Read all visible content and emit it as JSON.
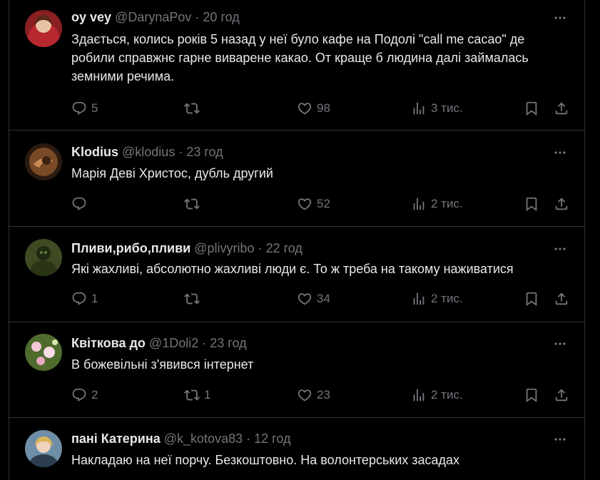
{
  "tweets": [
    {
      "name": "oy vey",
      "handle": "@DarynaPov",
      "time": "20 год",
      "text": "Здається, колись років 5 назад у неї було кафе на Подолі \"call me cacao\" де робили справжнє гарне виварене какао. От краще б людина далі займалась земними речима.",
      "replies": "5",
      "reposts": "",
      "likes": "98",
      "views": "3 тис."
    },
    {
      "name": "Klodius",
      "handle": "@klodius",
      "time": "23 год",
      "text": "Марія Деві Христос, дубль другий",
      "replies": "",
      "reposts": "",
      "likes": "52",
      "views": "2 тис."
    },
    {
      "name": "Пливи,рибо,пливи",
      "handle": "@plivyribo",
      "time": "22 год",
      "text": "Які жахливі, абсолютно жахливі люди є. То ж треба на такому наживатися",
      "replies": "1",
      "reposts": "",
      "likes": "34",
      "views": "2 тис."
    },
    {
      "name": "Квіткова до",
      "handle": "@1Doli2",
      "time": "23 год",
      "text": "В божевільні з'явився інтернет",
      "replies": "2",
      "reposts": "1",
      "likes": "23",
      "views": "2 тис."
    },
    {
      "name": "пані Катерина",
      "handle": "@k_kotova83",
      "time": "12 год",
      "text": "Накладаю на неї порчу. Безкоштовно. На волонтерських засадах"
    }
  ],
  "separator": "·",
  "icons": {
    "more": "more-dots-icon",
    "reply": "reply-icon",
    "repost": "repost-icon",
    "like": "heart-icon",
    "views": "views-icon",
    "bookmark": "bookmark-icon",
    "share": "share-icon"
  },
  "colors": {
    "background": "#000000",
    "text": "#e7e9ea",
    "muted": "#71767b",
    "border": "#2f3336"
  }
}
